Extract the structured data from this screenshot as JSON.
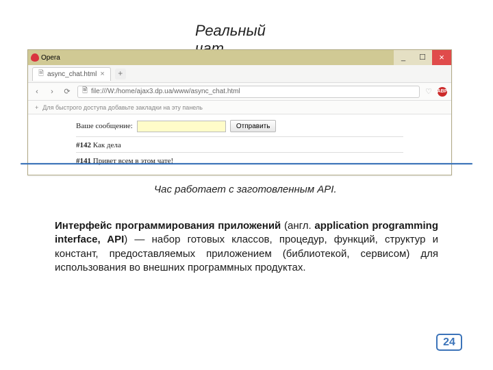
{
  "slide": {
    "title_line1": "Реальный",
    "title_line2": "чат",
    "subtitle": "Час работает с заготовленным API.",
    "paragraph_bold": "Интерфейс программирования приложений",
    "paragraph_mid1": " (англ. ",
    "paragraph_bold2": "application programming interface, API",
    "paragraph_rest": ") — набор готовых классов, процедур, функций, структур и констант, предоставляемых приложением (библиотекой, сервисом) для использования во внешних программных продуктах.",
    "page_number": "24"
  },
  "browser": {
    "brand": "Opera",
    "win": {
      "min": "_",
      "max": "☐",
      "close": "×"
    },
    "tab": {
      "title": "async_chat.html",
      "close": "×",
      "newtab": "+"
    },
    "nav": {
      "back": "‹",
      "fwd": "›",
      "reload": "⟳",
      "file_icon": "🗎"
    },
    "url": "file:///W:/home/ajax3.dp.ua/www/async_chat.html",
    "heart": "♡",
    "abp": "ABP",
    "bookmark_plus": "+",
    "bookmark_hint": "Для быстрого доступа добавьте закладки на эту панель"
  },
  "chat": {
    "label": "Ваше сообщение:",
    "send": "Отправить",
    "messages": [
      {
        "id": "#142",
        "text": " Как дела"
      },
      {
        "id": "#141",
        "text": " Привет всем в этом чате!"
      }
    ]
  }
}
